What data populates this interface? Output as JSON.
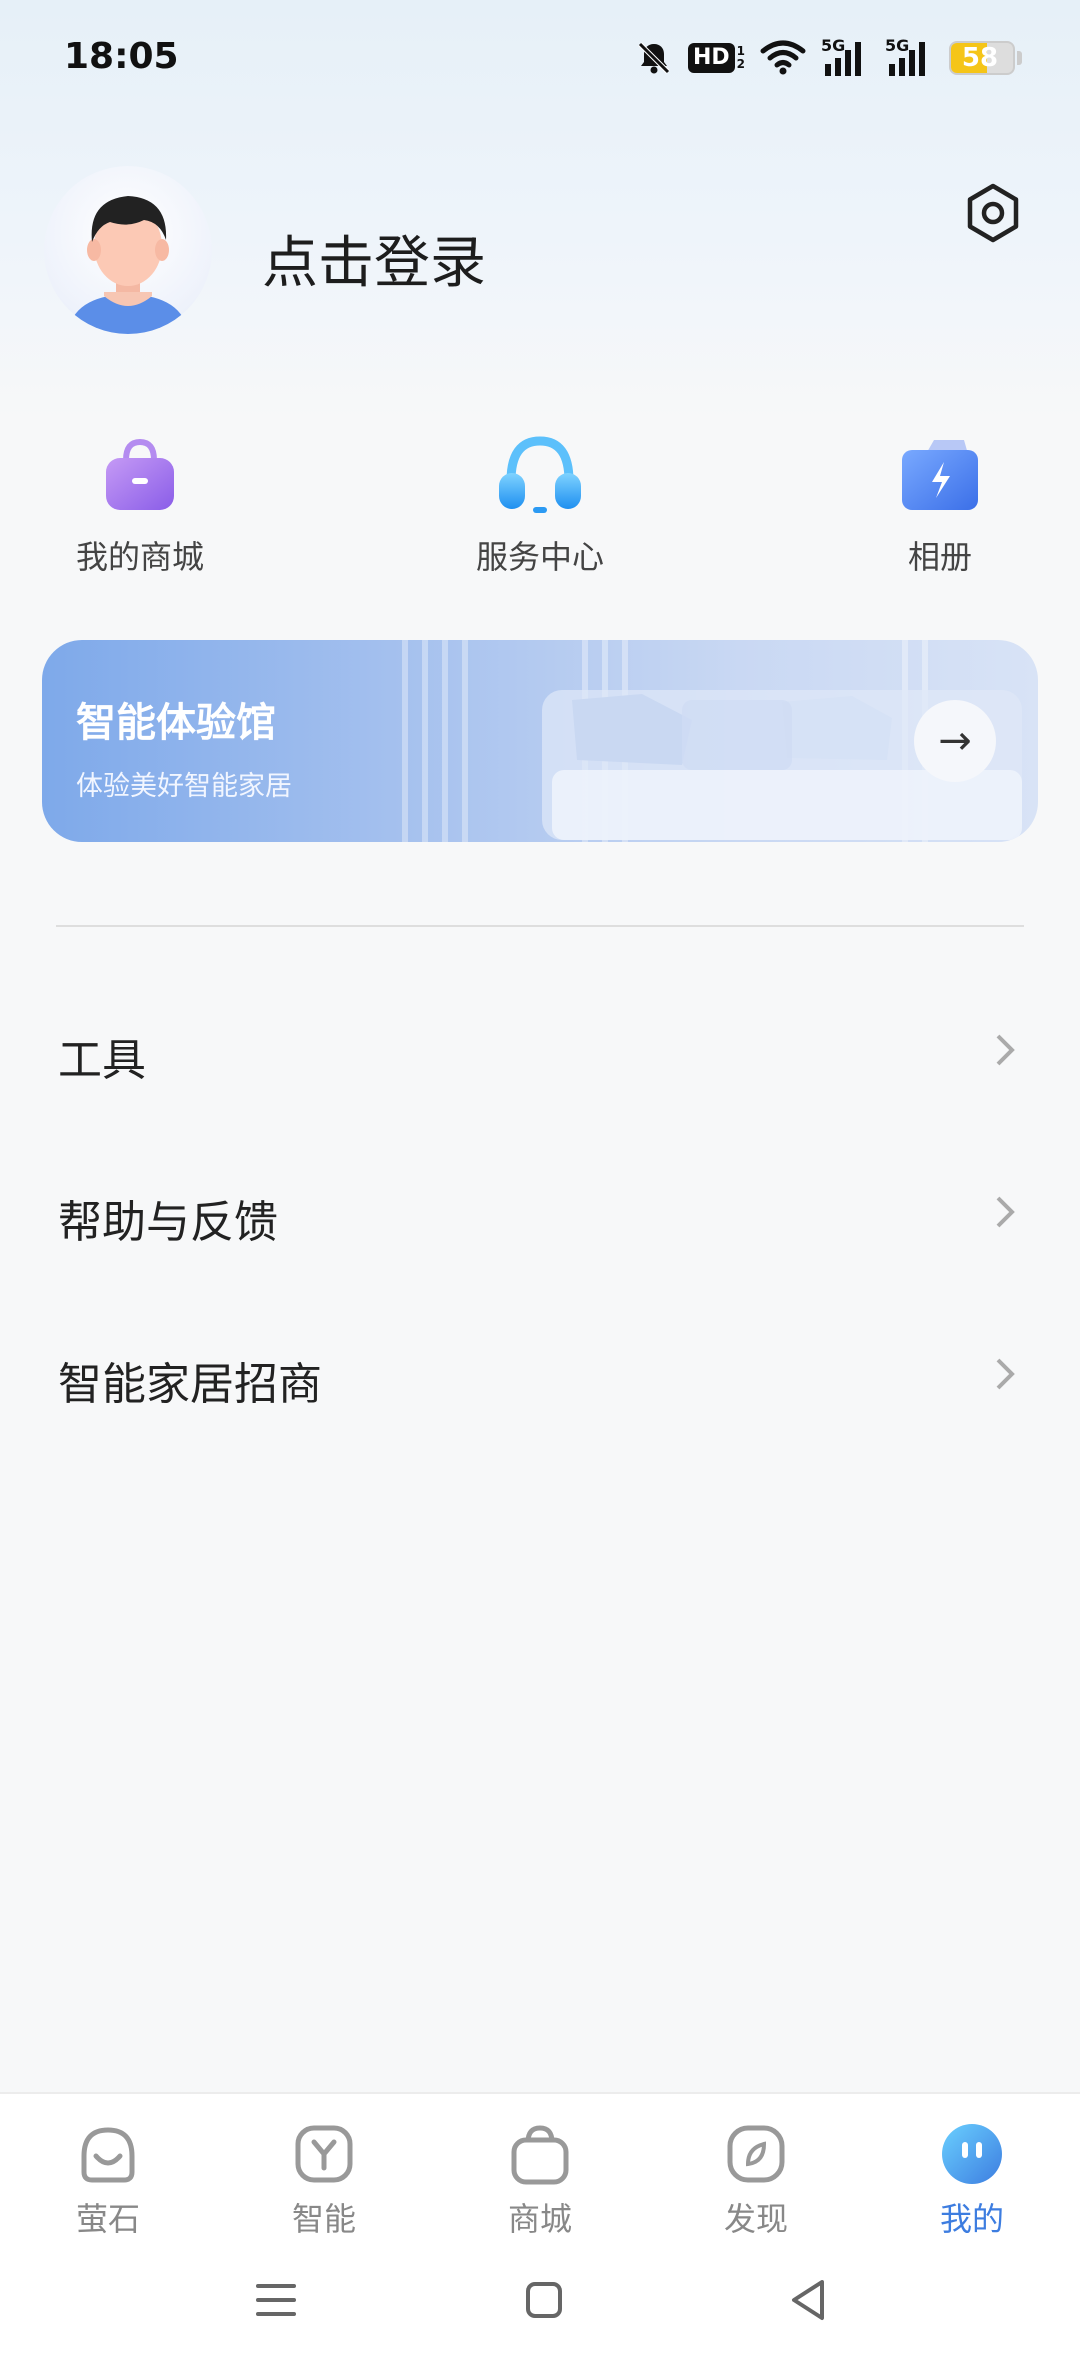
{
  "status_bar": {
    "time": "18:05",
    "hd_label": "HD",
    "hd_sub_top": "1",
    "hd_sub_bottom": "2",
    "sim1_label": "5G",
    "sim2_label": "5G",
    "battery_percent": "58",
    "battery_level": 0.58,
    "battery_color": "#f5c518"
  },
  "profile": {
    "login_text": "点击登录"
  },
  "quick_entries": [
    {
      "label": "我的商城",
      "icon": "shopping-bag-icon"
    },
    {
      "label": "服务中心",
      "icon": "headset-icon"
    },
    {
      "label": "相册",
      "icon": "album-icon"
    }
  ],
  "banner": {
    "title": "智能体验馆",
    "subtitle": "体验美好智能家居",
    "arrow": "→"
  },
  "menu": [
    {
      "label": "工具"
    },
    {
      "label": "帮助与反馈"
    },
    {
      "label": "智能家居招商"
    }
  ],
  "bottom_nav": [
    {
      "label": "萤石",
      "icon": "home-icon",
      "active": false
    },
    {
      "label": "智能",
      "icon": "smart-icon",
      "active": false
    },
    {
      "label": "商城",
      "icon": "mall-bag-icon",
      "active": false
    },
    {
      "label": "发现",
      "icon": "discover-icon",
      "active": false
    },
    {
      "label": "我的",
      "icon": "me-icon",
      "active": true
    }
  ],
  "colors": {
    "accent": "#3d7de0",
    "inactive": "#888888"
  }
}
